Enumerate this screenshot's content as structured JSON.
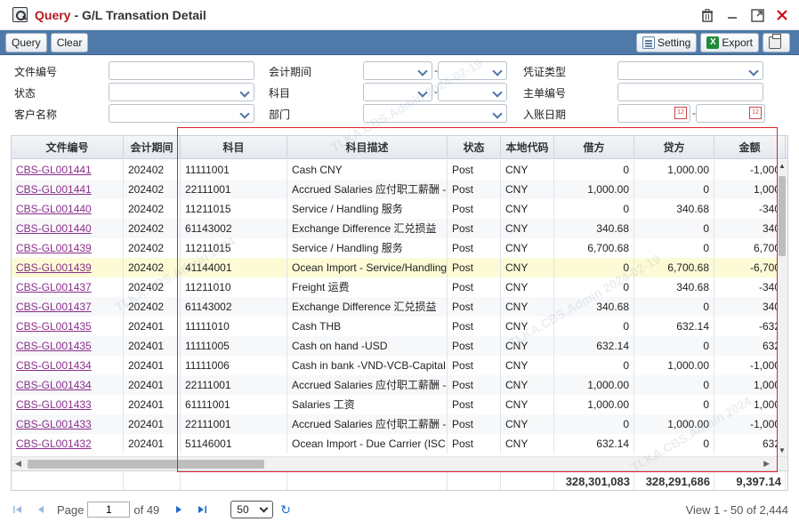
{
  "window": {
    "title_main": "Query",
    "title_rest": "- G/L Transation Detail"
  },
  "toolbar": {
    "query_label": "Query",
    "clear_label": "Clear",
    "setting_label": "Setting",
    "export_label": "Export"
  },
  "form": {
    "doc_no_label": "文件编号",
    "status_label": "状态",
    "customer_label": "客户名称",
    "period_label": "会计期间",
    "account_label": "科目",
    "dept_label": "部门",
    "voucher_type_label": "凭证类型",
    "master_no_label": "主单编号",
    "posting_date_label": "入账日期",
    "dash": "-"
  },
  "grid": {
    "columns": [
      "文件编号",
      "会计期间",
      "科目",
      "科目描述",
      "状态",
      "本地代码",
      "借方",
      "贷方",
      "金额"
    ],
    "rows": [
      {
        "doc": "CBS-GL001441",
        "period": "202402",
        "account": "11111001",
        "desc": "Cash CNY",
        "status": "Post",
        "cur": "CNY",
        "debit": "0",
        "credit": "1,000.00",
        "amount": "-1,000"
      },
      {
        "doc": "CBS-GL001441",
        "period": "202402",
        "account": "22111001",
        "desc": "Accrued Salaries 应付职工薪酬 -",
        "status": "Post",
        "cur": "CNY",
        "debit": "1,000.00",
        "credit": "0",
        "amount": "1,000"
      },
      {
        "doc": "CBS-GL001440",
        "period": "202402",
        "account": "11211015",
        "desc": "Service / Handling 服务",
        "status": "Post",
        "cur": "CNY",
        "debit": "0",
        "credit": "340.68",
        "amount": "-340"
      },
      {
        "doc": "CBS-GL001440",
        "period": "202402",
        "account": "61143002",
        "desc": "Exchange Difference 汇兑损益",
        "status": "Post",
        "cur": "CNY",
        "debit": "340.68",
        "credit": "0",
        "amount": "340"
      },
      {
        "doc": "CBS-GL001439",
        "period": "202402",
        "account": "11211015",
        "desc": "Service / Handling 服务",
        "status": "Post",
        "cur": "CNY",
        "debit": "6,700.68",
        "credit": "0",
        "amount": "6,700"
      },
      {
        "doc": "CBS-GL001439",
        "period": "202402",
        "account": "41144001",
        "desc": "Ocean Import - Service/Handling",
        "status": "Post",
        "cur": "CNY",
        "debit": "0",
        "credit": "6,700.68",
        "amount": "-6,700"
      },
      {
        "doc": "CBS-GL001437",
        "period": "202402",
        "account": "11211010",
        "desc": "Freight 运费",
        "status": "Post",
        "cur": "CNY",
        "debit": "0",
        "credit": "340.68",
        "amount": "-340"
      },
      {
        "doc": "CBS-GL001437",
        "period": "202402",
        "account": "61143002",
        "desc": "Exchange Difference 汇兑损益",
        "status": "Post",
        "cur": "CNY",
        "debit": "340.68",
        "credit": "0",
        "amount": "340"
      },
      {
        "doc": "CBS-GL001435",
        "period": "202401",
        "account": "11111010",
        "desc": "Cash THB",
        "status": "Post",
        "cur": "CNY",
        "debit": "0",
        "credit": "632.14",
        "amount": "-632"
      },
      {
        "doc": "CBS-GL001435",
        "period": "202401",
        "account": "11111005",
        "desc": "Cash on hand -USD",
        "status": "Post",
        "cur": "CNY",
        "debit": "632.14",
        "credit": "0",
        "amount": "632"
      },
      {
        "doc": "CBS-GL001434",
        "period": "202401",
        "account": "11111006",
        "desc": "Cash in bank -VND-VCB-Capital",
        "status": "Post",
        "cur": "CNY",
        "debit": "0",
        "credit": "1,000.00",
        "amount": "-1,000"
      },
      {
        "doc": "CBS-GL001434",
        "period": "202401",
        "account": "22111001",
        "desc": "Accrued Salaries 应付职工薪酬 -",
        "status": "Post",
        "cur": "CNY",
        "debit": "1,000.00",
        "credit": "0",
        "amount": "1,000"
      },
      {
        "doc": "CBS-GL001433",
        "period": "202401",
        "account": "61111001",
        "desc": "Salaries 工资",
        "status": "Post",
        "cur": "CNY",
        "debit": "1,000.00",
        "credit": "0",
        "amount": "1,000"
      },
      {
        "doc": "CBS-GL001433",
        "period": "202401",
        "account": "22111001",
        "desc": "Accrued Salaries 应付职工薪酬 -",
        "status": "Post",
        "cur": "CNY",
        "debit": "0",
        "credit": "1,000.00",
        "amount": "-1,000"
      },
      {
        "doc": "CBS-GL001432",
        "period": "202401",
        "account": "51146001",
        "desc": "Ocean Import - Due Carrier (ISC",
        "status": "Post",
        "cur": "CNY",
        "debit": "632.14",
        "credit": "0",
        "amount": "632"
      }
    ],
    "totals": {
      "debit": "328,301,083",
      "credit": "328,291,686",
      "amount": "9,397.14"
    }
  },
  "pager": {
    "page_label": "Page",
    "page_value": "1",
    "of_label": "of 49",
    "page_size": "50",
    "view_info": "View 1 - 50 of 2,444"
  },
  "icons": {
    "app": "magnifier-doc-icon",
    "trash": "trash-icon",
    "minimize": "minimize-icon",
    "maximize": "maximize-icon",
    "close": "close-icon"
  },
  "colors": {
    "title_accent": "#b2191f",
    "toolbar_bg": "#4f79a8",
    "link": "#8b2f8b",
    "highlight_row": "#fdfbd6",
    "selection_box": "#e0222a"
  }
}
